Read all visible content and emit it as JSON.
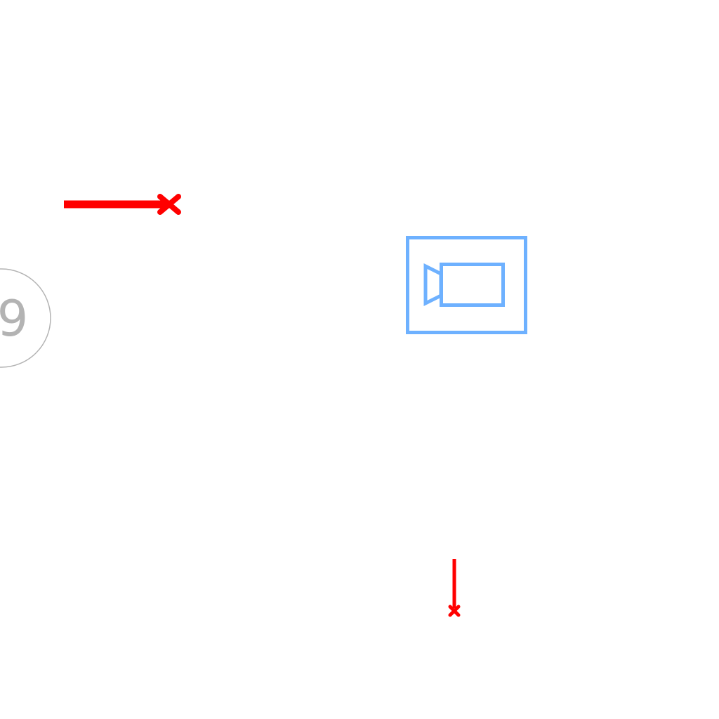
{
  "diagram": {
    "background": "#ffffff",
    "markers": [
      {
        "id": "marker-9",
        "label": "9",
        "color": "#b3b3b3"
      }
    ],
    "arrows": [
      {
        "id": "arrow-horizontal",
        "end_symbol": "x-cross",
        "color": "#ff0000"
      },
      {
        "id": "arrow-vertical",
        "end_symbol": "x-cross",
        "color": "#ff0000"
      }
    ],
    "icons": [
      {
        "id": "camera-block",
        "icon": "video-camera-icon",
        "color": "#6eb1ff"
      }
    ]
  }
}
